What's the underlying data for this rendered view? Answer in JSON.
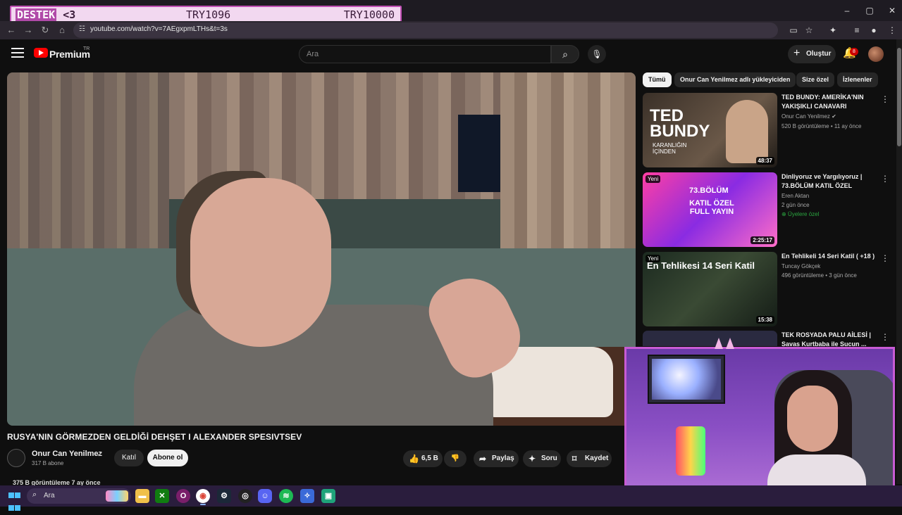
{
  "donation": {
    "label_prefix": "DESTEK",
    "label_suffix": "<3",
    "current": "TRY1096",
    "goal": "TRY10000"
  },
  "browser": {
    "url": "youtube.com/watch?v=7AEgxpmLTHs&t=3s",
    "window_controls": {
      "minimize": "–",
      "maximize": "▢",
      "close": "✕"
    }
  },
  "header": {
    "brand": "Premium",
    "region": "TR",
    "search_placeholder": "Ara",
    "create_label": "Oluştur",
    "notification_count": "8"
  },
  "video": {
    "title": "RUSYA'NIN GÖRMEZDEN GELDİĞİ DEHŞET I ALEXANDER SPESIVTSEV",
    "channel": "Onur Can Yenilmez",
    "subscribers": "317 B abone",
    "join_label": "Katıl",
    "subscribe_label": "Abone ol",
    "likes": "6,5 B",
    "share_label": "Paylaş",
    "ask_label": "Soru",
    "save_label": "Kaydet",
    "views_line": "375 B görüntüleme  7 ay önce"
  },
  "chips": [
    "Tümü",
    "Onur Can Yenilmez adlı yükleyiciden",
    "Size özel",
    "İzlenenler"
  ],
  "recommendations": [
    {
      "title": "TED BUNDY: AMERİKA'NIN YAKIŞIKLI CANAVARI",
      "channel": "Onur Can Yenilmez",
      "meta": "520 B görüntüleme • 11 ay önce",
      "duration": "48:37",
      "thumb_text": "TED BUNDY",
      "thumb_sub": "KARANLIĞIN İÇİNDEN"
    },
    {
      "title": "Dinliyoruz ve Yargılıyoruz | 73.BÖLÜM KATIL ÖZEL",
      "channel": "Eren Aktan",
      "meta": "2 gün önce",
      "members": "Üyelere özel",
      "duration": "2:25:17",
      "badge": "Yeni",
      "thumb_text": "73.BÖLÜM",
      "thumb_sub": "KATIL ÖZEL FULL YAYIN"
    },
    {
      "title": "En Tehlikeli 14 Seri Katil ( +18 )",
      "channel": "Tuncay Gökçek",
      "meta": "496 görüntüleme • 3 gün önce",
      "duration": "15:38",
      "badge": "Yeni",
      "thumb_text": "En Tehlikesi 14 Seri Katil"
    },
    {
      "title": "TEK ROSYADA PALU AİLESİ | Savaş Kurtbaba ile Suçun ..."
    }
  ],
  "taskbar": {
    "search_label": "Ara"
  },
  "colors": {
    "youtube_red": "#ff0000",
    "overlay_border": "#c85bd4",
    "taskbar_bg": "#2a1d3d"
  }
}
